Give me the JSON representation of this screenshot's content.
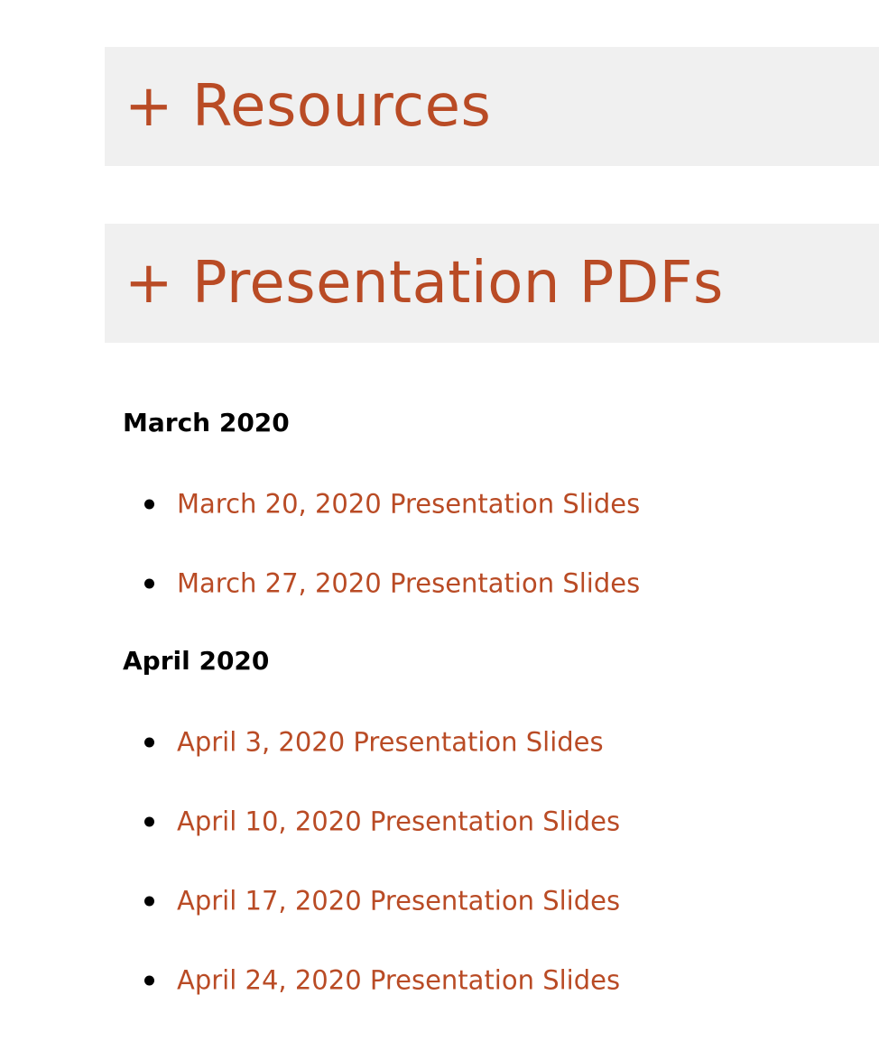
{
  "accordions": [
    {
      "label": "+ Resources"
    },
    {
      "label": "+ Presentation PDFs"
    }
  ],
  "months": [
    {
      "heading": "March 2020",
      "links": [
        "March 20, 2020 Presentation Slides",
        "March 27, 2020 Presentation Slides"
      ]
    },
    {
      "heading": "April 2020",
      "links": [
        "April 3, 2020 Presentation Slides",
        "April 10, 2020 Presentation Slides",
        "April 17, 2020 Presentation Slides",
        "April 24, 2020 Presentation Slides"
      ]
    }
  ],
  "colors": {
    "accent": "#b94b25",
    "header_bg": "#f0f0f0",
    "heading_text": "#000000"
  }
}
